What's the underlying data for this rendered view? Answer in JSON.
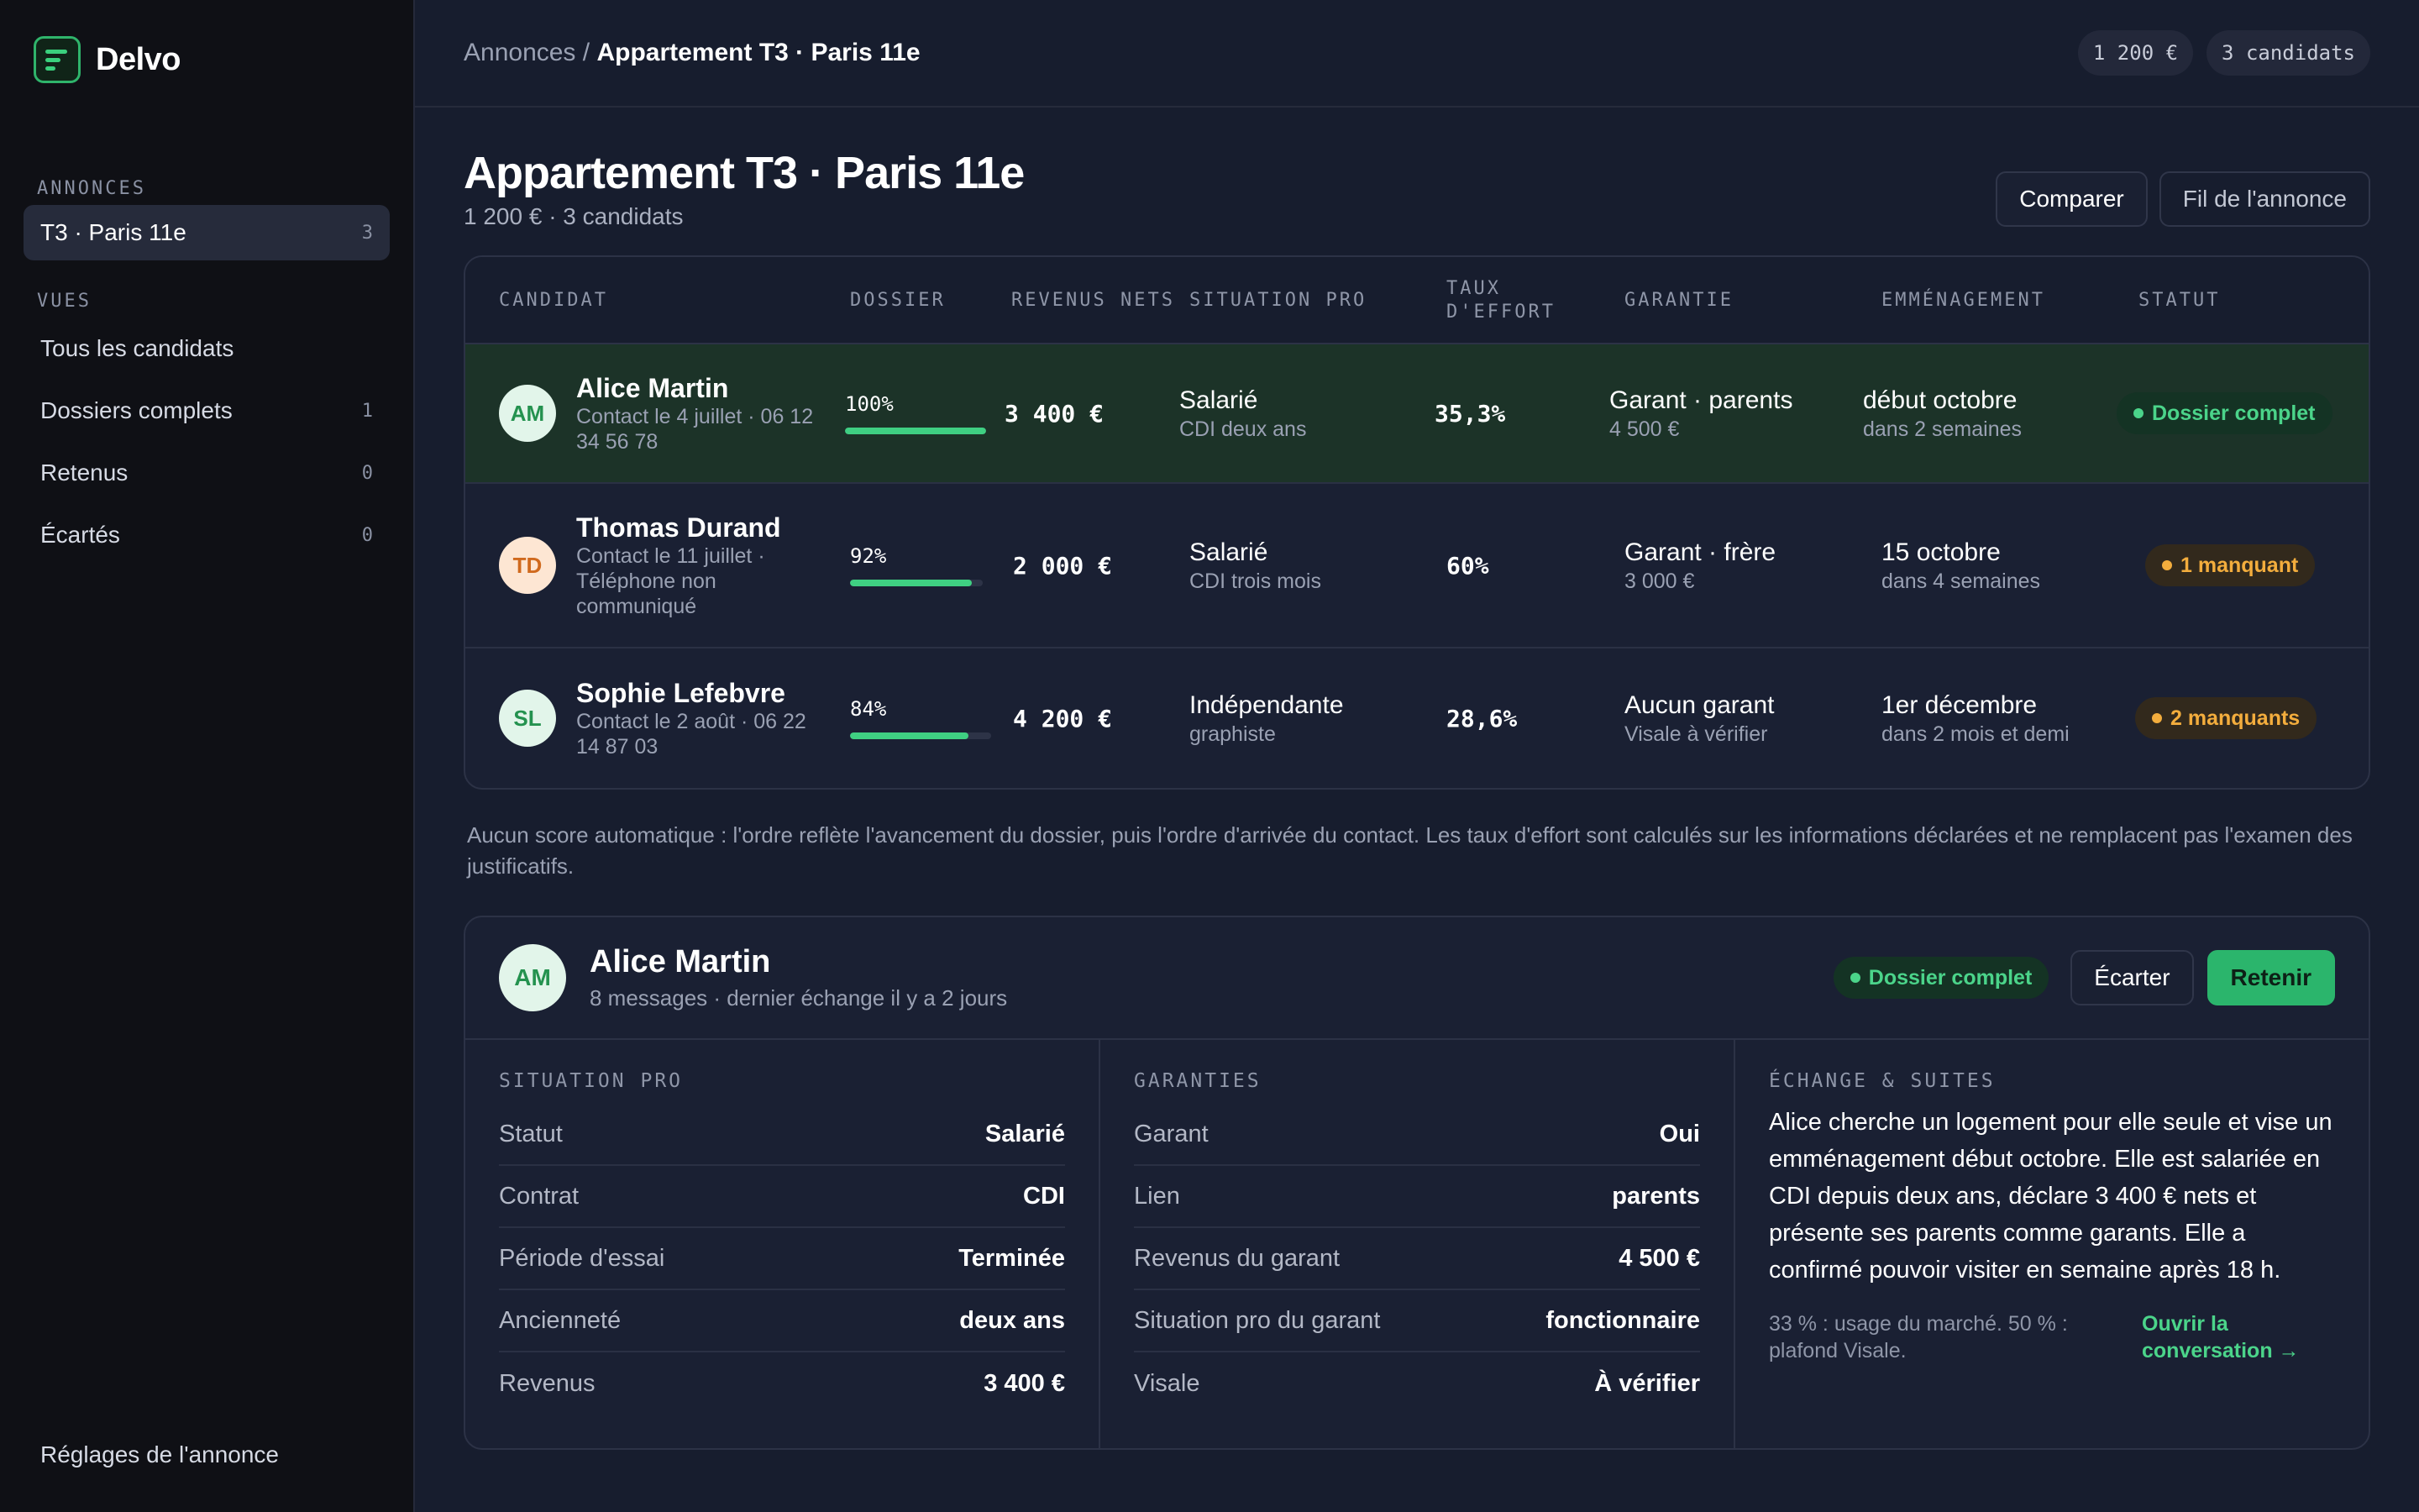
{
  "brand": {
    "name": "Delvo",
    "icon": "delvo-logo-icon"
  },
  "sidebar": {
    "section_annonces": "ANNONCES",
    "annonce": {
      "label": "T3 · Paris 11e",
      "count": "3"
    },
    "section_vues": "VUES",
    "vues": [
      {
        "label": "Tous les candidats",
        "count": ""
      },
      {
        "label": "Dossiers complets",
        "count": "1"
      },
      {
        "label": "Retenus",
        "count": "0"
      },
      {
        "label": "Écartés",
        "count": "0"
      }
    ],
    "footer": "Réglages de l'annonce"
  },
  "topbar": {
    "crumb_parent": "Annonces",
    "crumb_sep": " / ",
    "crumb_current": "Appartement T3 · Paris 11e",
    "pill_price": "1 200 €",
    "pill_candidates": "3 candidats"
  },
  "header": {
    "title": "Appartement T3 · Paris 11e",
    "subtitle": "1 200 € · 3 candidats",
    "compare_label": "Comparer",
    "thread_label": "Fil de l'annonce"
  },
  "table": {
    "columns": {
      "candidat": "CANDIDAT",
      "dossier": "DOSSIER",
      "revenus": "REVENUS NETS",
      "situation": "SITUATION PRO",
      "taux_1": "TAUX",
      "taux_2": "D'EFFORT",
      "garantie": "GARANTIE",
      "emmenagement": "EMMÉNAGEMENT",
      "statut": "STATUT"
    },
    "rows": [
      {
        "initials": "AM",
        "name": "Alice Martin",
        "contact": "Contact le 4 juillet · 06 12 34 56 78",
        "dossier_label": "100%",
        "dossier_value": 100,
        "revenus": "3 400 €",
        "situation": "Salarié",
        "situation_sub": "CDI deux ans",
        "taux": "35,3%",
        "garantie": "Garant · parents",
        "garantie_sub": "4 500 €",
        "emmenagement": "début octobre",
        "emmenagement_sub": "dans 2 semaines",
        "statut": "Dossier complet"
      },
      {
        "initials": "TD",
        "name": "Thomas Durand",
        "contact": "Contact le 11 juillet · Téléphone non communiqué",
        "dossier_label": "92%",
        "dossier_value": 92,
        "revenus": "2 000 €",
        "situation": "Salarié",
        "situation_sub": "CDI trois mois",
        "taux": "60%",
        "garantie": "Garant · frère",
        "garantie_sub": "3 000 €",
        "emmenagement": "15 octobre",
        "emmenagement_sub": "dans 4 semaines",
        "statut": "1 manquant"
      },
      {
        "initials": "SL",
        "name": "Sophie Lefebvre",
        "contact": "Contact le 2 août · 06 22 14 87 03",
        "dossier_label": "84%",
        "dossier_value": 84,
        "revenus": "4 200 €",
        "situation": "Indépendante",
        "situation_sub": "graphiste",
        "taux": "28,6%",
        "garantie": "Aucun garant",
        "garantie_sub": "Visale à vérifier",
        "emmenagement": "1er décembre",
        "emmenagement_sub": "dans 2 mois et demi",
        "statut": "2 manquants"
      }
    ]
  },
  "note": "Aucun score automatique : l'ordre reflète l'avancement du dossier, puis l'ordre d'arrivée du contact. Les taux d'effort sont calculés sur les informations déclarées et ne remplacent pas l'examen des justificatifs.",
  "detail": {
    "initials": "AM",
    "name": "Alice Martin",
    "sub": "8 messages · dernier échange il y a 2 jours",
    "badge": "Dossier complet",
    "reject_label": "Écarter",
    "keep_label": "Retenir",
    "situation": {
      "title": "SITUATION PRO",
      "items": [
        {
          "k": "Statut",
          "v": "Salarié"
        },
        {
          "k": "Contrat",
          "v": "CDI"
        },
        {
          "k": "Période d'essai",
          "v": "Terminée"
        },
        {
          "k": "Ancienneté",
          "v": "deux ans"
        },
        {
          "k": "Revenus",
          "v": "3 400 €"
        }
      ]
    },
    "garanties": {
      "title": "GARANTIES",
      "items": [
        {
          "k": "Garant",
          "v": "Oui"
        },
        {
          "k": "Lien",
          "v": "parents"
        },
        {
          "k": "Revenus du garant",
          "v": "4 500 €"
        },
        {
          "k": "Situation pro du garant",
          "v": "fonctionnaire"
        },
        {
          "k": "Visale",
          "v": "À vérifier"
        }
      ]
    },
    "echange": {
      "title": "ÉCHANGE & SUITES",
      "text": "Alice cherche un logement pour elle seule et vise un emménagement début octobre. Elle est salariée en CDI depuis deux ans, déclare 3 400 € nets et présente ses parents comme garants. Elle a confirmé pouvoir visiter en semaine après 18 h.",
      "hint": "33 % : usage du marché. 50 % : plafond Visale.",
      "link": "Ouvrir la conversation →"
    }
  },
  "colors": {
    "accent": "#2bb56c",
    "warning": "#f3ad3d",
    "background": "#171d2e",
    "sidebar": "#0f1015"
  }
}
